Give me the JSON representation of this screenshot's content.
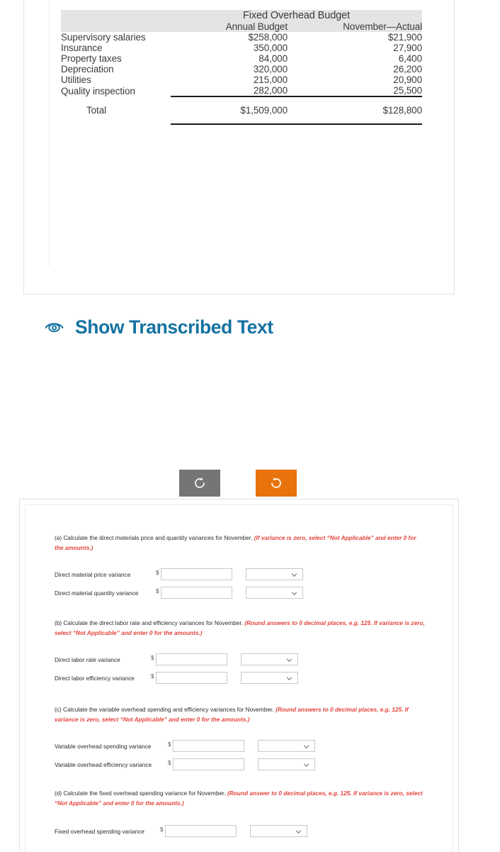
{
  "table": {
    "title": "Fixed Overhead Budget",
    "columns": [
      "",
      "Annual Budget",
      "November—Actual"
    ],
    "rows": [
      {
        "label": "Supervisory salaries",
        "annual": "$258,000",
        "actual": "$21,900"
      },
      {
        "label": "Insurance",
        "annual": "350,000",
        "actual": "27,900"
      },
      {
        "label": "Property taxes",
        "annual": "84,000",
        "actual": "6,400"
      },
      {
        "label": "Depreciation",
        "annual": "320,000",
        "actual": "26,200"
      },
      {
        "label": "Utilities",
        "annual": "215,000",
        "actual": "20,900"
      },
      {
        "label": "Quality inspection",
        "annual": "282,000",
        "actual": "25,500"
      }
    ],
    "total": {
      "label": "Total",
      "annual": "$1,509,000",
      "actual": "$128,800"
    }
  },
  "transcribe": {
    "label": "Show Transcribed Text",
    "icon": "eye-icon",
    "color": "#1572a1"
  },
  "actions": {
    "undo": {
      "icon": "undo-arrow-icon",
      "color": "#757575"
    },
    "redo": {
      "icon": "redo-arrow-icon",
      "color": "#e8730c"
    }
  },
  "form": {
    "questions": [
      {
        "prompt": "(a) Calculate the direct materials price and quantity variances for November. ",
        "hint": "(If variance is zero, select “Not Applicable” and enter 0 for the amounts.)",
        "fields": [
          {
            "label": "Direct material price variance",
            "currency": "$",
            "value": "",
            "select_value": ""
          },
          {
            "label": "Direct material quantity variance",
            "currency": "$",
            "value": "",
            "select_value": ""
          }
        ]
      },
      {
        "prompt": "(b) Calculate the direct labor rate and efficiency variances for November. ",
        "hint": "(Round answers to 0 decimal places, e.g. 125. If variance is zero, select “Not Applicable” and enter 0 for the amounts.)",
        "fields": [
          {
            "label": "Direct labor rate variance",
            "currency": "$",
            "value": "",
            "select_value": ""
          },
          {
            "label": "Direct labor efficiency variance",
            "currency": "$",
            "value": "",
            "select_value": ""
          }
        ]
      },
      {
        "prompt": "(c) Calculate the variable overhead spending and efficiency variances for November. ",
        "hint": "(Round answers to 0 decimal places, e.g. 125. If variance is zero, select “Not Applicable” and enter 0 for the amounts.)",
        "fields": [
          {
            "label": "Variable overhead spending variance",
            "currency": "$",
            "value": "",
            "select_value": ""
          },
          {
            "label": "Variable overhead efficiency variance",
            "currency": "$",
            "value": "",
            "select_value": ""
          }
        ]
      },
      {
        "prompt": "(d) Calculate the fixed overhead spending variance for November. ",
        "hint": "(Round answer to 0 decimal places, e.g. 125. If variance is zero, select “Not Applicable” and enter 0 for the amounts.)",
        "fields": [
          {
            "label": "Fixed overhead spending variance",
            "currency": "$",
            "value": "",
            "select_value": ""
          }
        ]
      }
    ]
  }
}
